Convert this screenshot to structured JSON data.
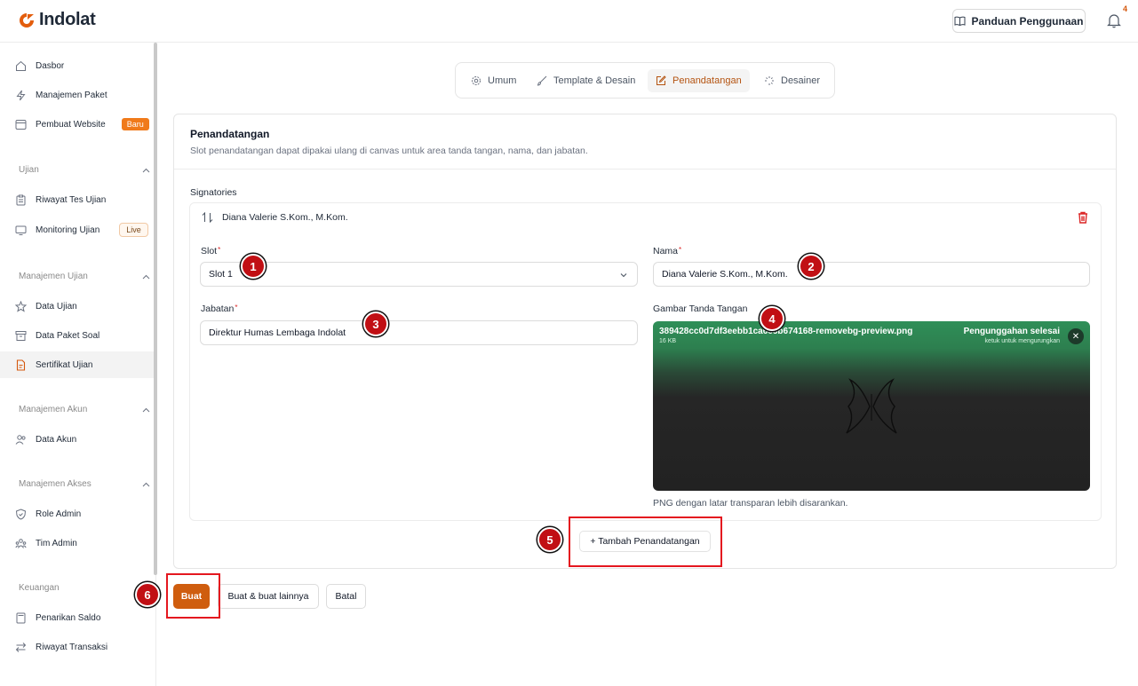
{
  "app": {
    "name": "Indolat",
    "brand_color": "#e35d0c"
  },
  "header": {
    "guide_label": "Panduan Penggunaan",
    "notification_count": "4"
  },
  "sidebar": {
    "items_top": [
      {
        "label": "Dasbor",
        "icon": "home-icon"
      },
      {
        "label": "Manajemen Paket",
        "icon": "bolt-icon"
      },
      {
        "label": "Pembuat Website",
        "icon": "browser-icon",
        "badge": "Baru"
      }
    ],
    "sections": [
      {
        "title": "Ujian",
        "items": [
          {
            "label": "Riwayat Tes Ujian",
            "icon": "clipboard-icon"
          },
          {
            "label": "Monitoring Ujian",
            "icon": "monitor-icon",
            "badge": "Live"
          }
        ]
      },
      {
        "title": "Manajemen Ujian",
        "items": [
          {
            "label": "Data Ujian",
            "icon": "star-icon"
          },
          {
            "label": "Data Paket Soal",
            "icon": "archive-icon"
          },
          {
            "label": "Sertifikat Ujian",
            "icon": "certificate-icon",
            "active": true
          }
        ]
      },
      {
        "title": "Manajemen Akun",
        "items": [
          {
            "label": "Data Akun",
            "icon": "users-icon"
          }
        ]
      },
      {
        "title": "Manajemen Akses",
        "items": [
          {
            "label": "Role Admin",
            "icon": "shield-check-icon"
          },
          {
            "label": "Tim Admin",
            "icon": "team-icon"
          }
        ]
      },
      {
        "title": "Keuangan",
        "items": [
          {
            "label": "Penarikan Saldo",
            "icon": "calculator-icon"
          },
          {
            "label": "Riwayat Transaksi",
            "icon": "arrows-swap-icon"
          }
        ]
      }
    ]
  },
  "tabs": [
    {
      "label": "Umum",
      "icon": "settings-icon"
    },
    {
      "label": "Template & Desain",
      "icon": "brush-icon"
    },
    {
      "label": "Penandatangan",
      "icon": "edit-icon",
      "active": true
    },
    {
      "label": "Desainer",
      "icon": "sparkle-icon"
    }
  ],
  "section": {
    "title": "Penandatangan",
    "description": "Slot penandatangan dapat dipakai ulang di canvas untuk area tanda tangan, nama, dan jabatan.",
    "signatories_label": "Signatories"
  },
  "signatory": {
    "header_name": "Diana Valerie S.Kom., M.Kom.",
    "slot_label": "Slot",
    "slot_value": "Slot 1",
    "name_label": "Nama",
    "name_value": "Diana Valerie S.Kom., M.Kom.",
    "position_label": "Jabatan",
    "position_value": "Direktur Humas Lembaga Indolat",
    "signature_label": "Gambar Tanda Tangan",
    "upload": {
      "filename": "389428cc0d7df3eebb1ca6c5b674168-removebg-preview.png",
      "size": "16 KB",
      "status": "Pengunggahan selesai",
      "tap_hint": "ketuk untuk mengurungkan"
    },
    "hint": "PNG dengan latar transparan lebih disarankan."
  },
  "actions": {
    "add_signatory": "+ Tambah Penandatangan",
    "create": "Buat",
    "create_more": "Buat & buat lainnya",
    "cancel": "Batal"
  },
  "annotations": [
    "1",
    "2",
    "3",
    "4",
    "5",
    "6"
  ]
}
